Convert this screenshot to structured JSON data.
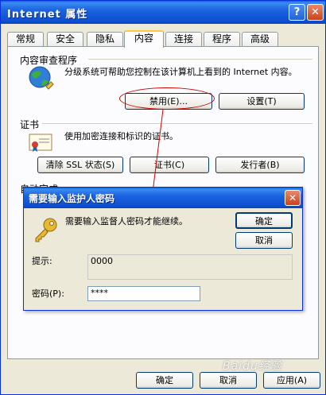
{
  "window": {
    "title": "Internet 属性",
    "help": "?",
    "close": "✕"
  },
  "tabs": [
    "常规",
    "安全",
    "隐私",
    "内容",
    "连接",
    "程序",
    "高级"
  ],
  "content_advisor": {
    "title": "内容审查程序",
    "description": "分级系统可帮助您控制在该计算机上看到的 Internet 内容。",
    "disable_button": "禁用(E)...",
    "settings_button": "设置(T)"
  },
  "certificates": {
    "title": "证书",
    "description": "使用加密连接和标识的证书。",
    "clear_ssl_button": "清除 SSL 状态(S)",
    "certificates_button": "证书(C)",
    "publishers_button": "发行者(B)"
  },
  "hidden_group": {
    "title": "自动完成"
  },
  "dialog": {
    "title": "需要输入监护人密码",
    "message": "需要输入监督人密码才能继续。",
    "ok_button": "确定",
    "cancel_button": "取消",
    "hint_label": "提示:",
    "hint_value": "0000",
    "password_label": "密码(P):",
    "password_value": "****"
  },
  "footer": {
    "ok_button": "确定",
    "cancel_button": "取消",
    "apply_button": "应用(A)"
  },
  "watermark": "Baidu经验",
  "colors": {
    "titlebar": "#0d4fd1",
    "annotation": "#d00000",
    "button_border": "#003c74"
  },
  "icons": [
    "globe-advisor-icon",
    "certificate-icon",
    "key-icon"
  ]
}
